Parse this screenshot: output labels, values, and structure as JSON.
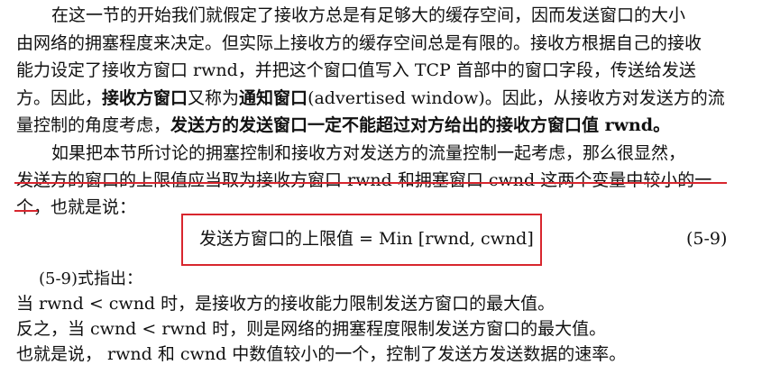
{
  "paragraph1": {
    "line1": "在这一节的开始我们就假定了接收方总是有足够大的缓存空间，因而发送窗口的大小",
    "line2": "由网络的拥塞程度来决定。但实际上接收方的缓存空间总是有限的。接收方根据自己的接收",
    "line3": "能力设定了接收方窗口 rwnd，并把这个窗口值写入 TCP 首部中的窗口字段，传送给发送",
    "line4_a": "方。因此，",
    "line4_b": "接收方窗口",
    "line4_c": "又称为",
    "line4_d": "通知窗口",
    "line4_e": "(advertised window)。因此，从接收方对发送方的流",
    "line5_a": "量控制的角度考虑，",
    "line5_b": "发送方的发送窗口一定不能超过对方给出的接收方窗口值 rwnd。"
  },
  "paragraph2": {
    "line1": "如果把本节所讨论的拥塞控制和接收方对发送方的流量控制一起考虑，那么很显然，",
    "line2": "发送方的窗口的上限值应当取为接收方窗口 rwnd 和拥塞窗口 cwnd 这两个变量中较小的一",
    "line3_a": "个",
    "line3_b": "，也就是说："
  },
  "formula": {
    "text": "发送方窗口的上限值 = Min [rwnd, cwnd]",
    "number": "(5-9)"
  },
  "explanation": {
    "line1": "(5-9)式指出：",
    "line2": "当 rwnd < cwnd 时，是接收方的接收能力限制发送方窗口的最大值。",
    "line3": "反之，当 cwnd < rwnd 时，则是网络的拥塞程度限制发送方窗口的最大值。",
    "line4": "也就是说， rwnd 和 cwnd 中数值较小的一个，控制了发送方发送数据的速率。"
  },
  "colors": {
    "annotation_red": "#d8262e",
    "text": "#111111"
  }
}
